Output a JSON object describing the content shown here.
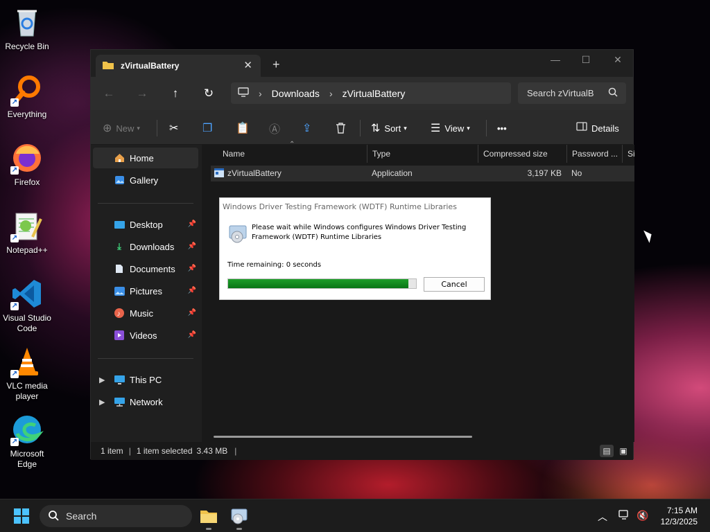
{
  "desktop": {
    "icons": [
      {
        "name": "recycle-bin",
        "label": "Recycle Bin"
      },
      {
        "name": "everything",
        "label": "Everything"
      },
      {
        "name": "firefox",
        "label": "Firefox"
      },
      {
        "name": "notepadpp",
        "label": "Notepad++"
      },
      {
        "name": "vscode",
        "label": "Visual Studio Code"
      },
      {
        "name": "vlc",
        "label": "VLC media player"
      },
      {
        "name": "edge",
        "label": "Microsoft Edge"
      }
    ]
  },
  "explorer": {
    "tab_title": "zVirtualBattery",
    "tab_close": "✕",
    "new_tab": "+",
    "controls": {
      "minimize": "—",
      "maximize": "☐",
      "close": "✕"
    },
    "address": {
      "segments": [
        "Downloads",
        "zVirtualBattery"
      ]
    },
    "search_placeholder": "Search zVirtualB",
    "toolbar": {
      "new": "New",
      "sort": "Sort",
      "view": "View",
      "more": "•••",
      "details": "Details"
    },
    "sidebar": {
      "home": "Home",
      "gallery": "Gallery",
      "quick": [
        {
          "label": "Desktop"
        },
        {
          "label": "Downloads"
        },
        {
          "label": "Documents"
        },
        {
          "label": "Pictures"
        },
        {
          "label": "Music"
        },
        {
          "label": "Videos"
        }
      ],
      "this_pc": "This PC",
      "network": "Network"
    },
    "columns": {
      "name": "Name",
      "type": "Type",
      "compressed": "Compressed size",
      "password": "Password ...",
      "size": "Si"
    },
    "files": [
      {
        "name": "zVirtualBattery",
        "type": "Application",
        "compressed": "3,197 KB",
        "password": "No"
      }
    ],
    "status": {
      "count": "1 item",
      "selected": "1 item selected",
      "size": "3.43 MB"
    }
  },
  "dialog": {
    "title": "Windows Driver Testing Framework (WDTF) Runtime Libraries",
    "message": "Please wait while Windows configures Windows Driver Testing Framework (WDTF) Runtime Libraries",
    "time_remaining": "Time remaining: 0 seconds",
    "progress": 0.96,
    "cancel": "Cancel"
  },
  "taskbar": {
    "search": "Search",
    "time": "7:15 AM",
    "date": "12/3/2025"
  },
  "colors": {
    "accent": "#4cc2ff",
    "progress": "#087515",
    "selection": "#2d2d2d"
  }
}
